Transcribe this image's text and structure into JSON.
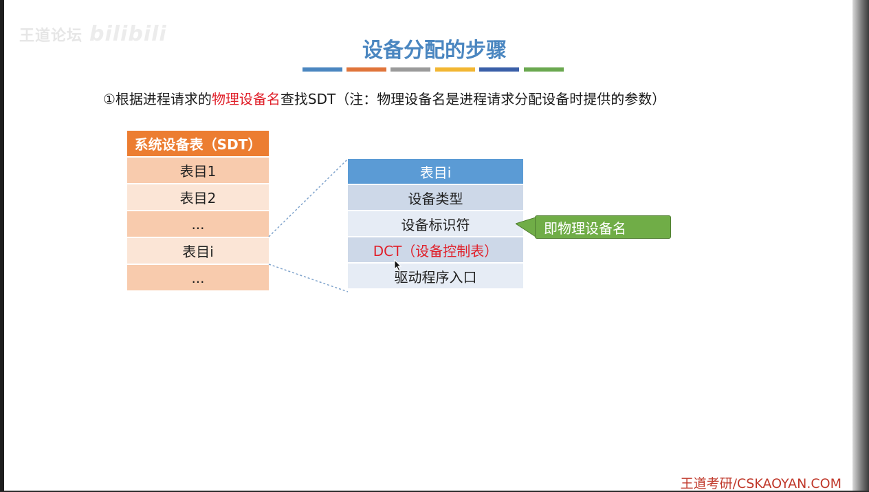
{
  "watermark": {
    "text": "王道论坛",
    "logo": "bilibili"
  },
  "slide": {
    "title": "设备分配的步骤",
    "title_bar_colors": [
      "#4a86c0",
      "#e0743a",
      "#9a9a9a",
      "#f2b632",
      "#3a5fa8",
      "#6aa84f"
    ],
    "step": {
      "prefix": "①根据进程请求的",
      "highlight": "物理设备名",
      "suffix": "查找SDT（注：物理设备名是进程请求分配设备时提供的参数）"
    }
  },
  "sdt": {
    "header": "系统设备表（SDT）",
    "rows": [
      "表目1",
      "表目2",
      "...",
      "表目i",
      "..."
    ]
  },
  "entry": {
    "header": "表目i",
    "rows": [
      "设备类型",
      "设备标识符",
      "DCT（设备控制表）",
      "驱动程序入口"
    ]
  },
  "callout": {
    "text": "即物理设备名"
  },
  "footer": {
    "text": "王道考研/CSKAOYAN.COM"
  }
}
